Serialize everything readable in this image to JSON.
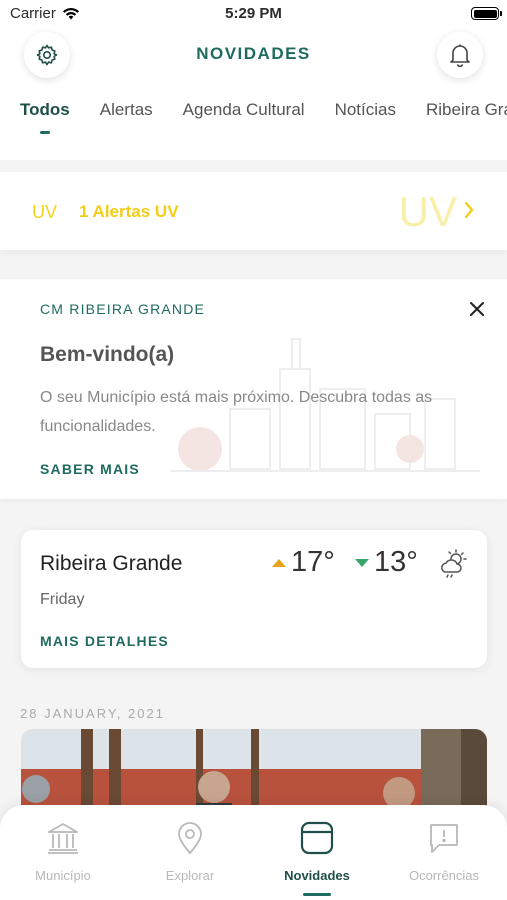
{
  "status_bar": {
    "carrier": "Carrier",
    "time": "5:29 PM"
  },
  "header": {
    "title": "NOVIDADES",
    "settings_icon": "gear-icon",
    "notifications_icon": "bell-icon",
    "accent_color": "#1f6b5f"
  },
  "tabs": [
    {
      "label": "Todos",
      "active": true
    },
    {
      "label": "Alertas"
    },
    {
      "label": "Agenda Cultural"
    },
    {
      "label": "Notícias"
    },
    {
      "label": "Ribeira Grande"
    }
  ],
  "uv_alert": {
    "small_label": "UV",
    "text": "1 Alertas UV",
    "watermark": "UV",
    "color": "#f3cd18"
  },
  "welcome": {
    "label": "CM RIBEIRA GRANDE",
    "title": "Bem-vindo(a)",
    "body": "O seu Município está mais próximo. Descubra todas as funcionalidades.",
    "link": "SABER MAIS"
  },
  "weather": {
    "city": "Ribeira Grande",
    "day": "Friday",
    "max": "17°",
    "min": "13°",
    "max_color": "#e6a21c",
    "min_color": "#3aa56a",
    "icon": "partly-cloudy-icon",
    "link": "MAIS DETALHES"
  },
  "feed": {
    "date": "28 JANUARY, 2021"
  },
  "bottom_nav": [
    {
      "label": "Município",
      "icon": "municipality-icon"
    },
    {
      "label": "Explorar",
      "icon": "location-pin-icon"
    },
    {
      "label": "Novidades",
      "icon": "news-icon",
      "active": true
    },
    {
      "label": "Ocorrências",
      "icon": "report-icon"
    }
  ]
}
